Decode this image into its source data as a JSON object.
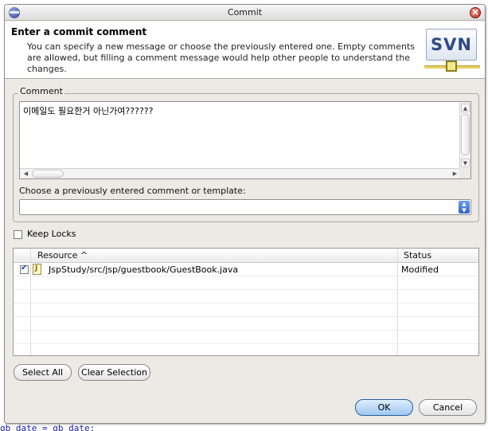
{
  "window": {
    "title": "Commit"
  },
  "header": {
    "title": "Enter a commit comment",
    "description": "You can specify a new message or choose the previously entered one. Empty comments are allowed, but filling a comment message would help other people to understand the changes.",
    "logo_text": "SVN"
  },
  "comment": {
    "group_label": "Comment",
    "value": "이메일도 필요한거 아닌가여??????",
    "previous_label": "Choose a previously entered comment or template:",
    "previous_value": ""
  },
  "keep_locks": {
    "label": "Keep Locks",
    "checked": false
  },
  "resources": {
    "columns": [
      "Resource ^",
      "Status"
    ],
    "rows": [
      {
        "checked": true,
        "resource": "JspStudy/src/jsp/guestbook/GuestBook.java",
        "status": "Modified"
      }
    ]
  },
  "buttons": {
    "select_all": "Select All",
    "clear_selection": "Clear Selection",
    "ok": "OK",
    "cancel": "Cancel"
  },
  "background_editor": {
    "code_line": "gb_date = gb_date;"
  },
  "colors": {
    "dialog_bg": "#eceae4",
    "accent": "#2f62c8",
    "svn_blue": "#2c4a86"
  }
}
